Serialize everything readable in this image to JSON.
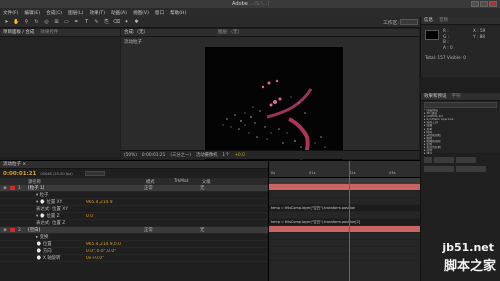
{
  "titlebar": {
    "app_title": "Adobe",
    "sub_title": " ...(S:\\...)"
  },
  "menu": [
    "文件(F)",
    "编辑(E)",
    "合成(C)",
    "图层(L)",
    "效果(T)",
    "动画(A)",
    "视图(V)",
    "窗口",
    "帮助(H)"
  ],
  "toolbar": {
    "workspace_label": "工作区:"
  },
  "project": {
    "tab": "项目面板 / 合成",
    "tab2": "效果控件"
  },
  "viewer": {
    "tab": "合成:（无）",
    "tab2": "图层:（无）",
    "breadcrumb": "流动粒子",
    "zoom": "(50%)",
    "timecode": "0:00:01:21",
    "quality": "(三分之一)",
    "view": "活动摄像机",
    "views": "1个",
    "offset": "+0.0"
  },
  "info": {
    "tab": "信息",
    "tab2": "音频",
    "r": "R :",
    "g": "G :",
    "b": "B :",
    "a": "A : 0",
    "x": "X : 59",
    "y": "Y : 88",
    "stats": "Total: 157  Visible: 0"
  },
  "effects": {
    "tab": "效果和预设",
    "tab2": "字符",
    "items": [
      "* 动画预设",
      "▸ 3D 通道",
      "▸ CINEMA 4D",
      "▸ Synthetic Aperture",
      "▸ 实用工具",
      "▸ 扭曲",
      "▸ 文本",
      "▸ 时间",
      "▸ 杂色和颗粒",
      "▸ 模拟",
      "▸ 模糊和锐化",
      "▸ 生成",
      "▸ 表达式控制",
      "▸ 过时",
      "▸ 通道",
      "▸ 遮罩"
    ]
  },
  "timeline": {
    "tab": "流动粒子 ×",
    "timecode": "0:00:01:21",
    "frames": "00046 (25.00 fps)",
    "source_header": "源名称",
    "mode_header": "模式",
    "trkmat_header": "TrkMat",
    "parent_header": "父级",
    "rows": [
      {
        "num": "1",
        "name": "[粒子 1]",
        "mode": "正常",
        "parent": "无",
        "value": "",
        "expr": ""
      },
      {
        "num": "",
        "name": "▾ 粒子",
        "mode": "",
        "parent": "",
        "value": "",
        "expr": ""
      },
      {
        "num": "",
        "name": "▾ ⌚ 位置 XY",
        "mode": "",
        "parent": "",
        "value": "965.4,214.9",
        "expr": ""
      },
      {
        "num": "",
        "name": "表达式: 位置 XY",
        "mode": "",
        "parent": "",
        "value": "",
        "expr": "temp = thisComp.layer(\"空白\").transform.position"
      },
      {
        "num": "",
        "name": "▾ ⌚ 位置 Z",
        "mode": "",
        "parent": "",
        "value": "0.0",
        "expr": ""
      },
      {
        "num": "",
        "name": "表达式: 位置 Z",
        "mode": "",
        "parent": "",
        "value": "",
        "expr": "temp = thisComp.layer(\"空白\").transform.position[2]"
      },
      {
        "num": "2",
        "name": "[空白]",
        "mode": "正常",
        "parent": "无",
        "value": "",
        "expr": ""
      },
      {
        "num": "",
        "name": "▸ 变换",
        "mode": "",
        "parent": "",
        "value": "",
        "expr": ""
      },
      {
        "num": "",
        "name": "⌚ 位置",
        "mode": "",
        "parent": "",
        "value": "965.4,214.9,0.0",
        "expr": ""
      },
      {
        "num": "",
        "name": "⌚ 方向",
        "mode": "",
        "parent": "",
        "value": "0.0°,0.0°,0.0°",
        "expr": ""
      },
      {
        "num": "",
        "name": "⌚ X 轴旋转",
        "mode": "",
        "parent": "",
        "value": "0x+0.0°",
        "expr": ""
      }
    ],
    "ruler": [
      "0s",
      "01s",
      "02s",
      "03s"
    ]
  },
  "watermark": {
    "site": "jb51.net",
    "cn": "脚本之家"
  },
  "colors": {
    "accent_red": "#d02b2b",
    "keyframe_pink": "#c86464",
    "timecode_orange": "#e0a030",
    "panel": "#232323"
  }
}
